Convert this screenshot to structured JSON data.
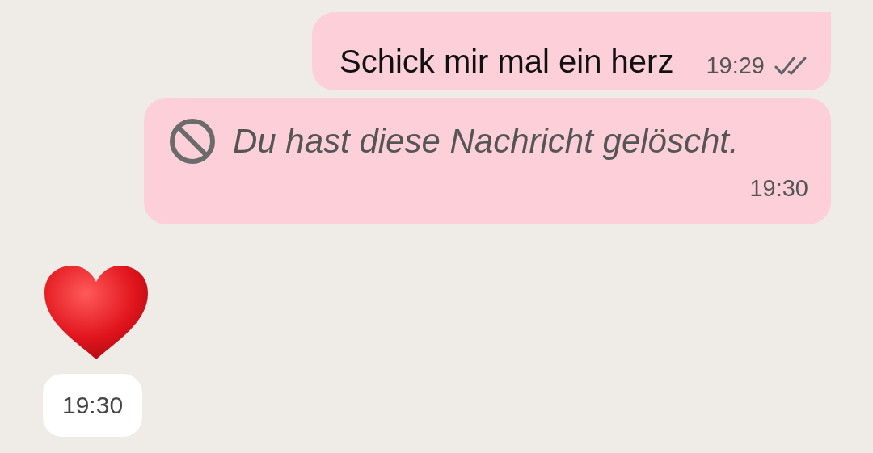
{
  "messages": [
    {
      "kind": "text",
      "outgoing": true,
      "text": "Schick mir mal ein herz",
      "time": "19:29",
      "read": false
    },
    {
      "kind": "deleted",
      "outgoing": true,
      "text": "Du hast diese Nachricht gelöscht.",
      "time": "19:30"
    },
    {
      "kind": "heart",
      "outgoing": false,
      "time": "19:30"
    }
  ]
}
